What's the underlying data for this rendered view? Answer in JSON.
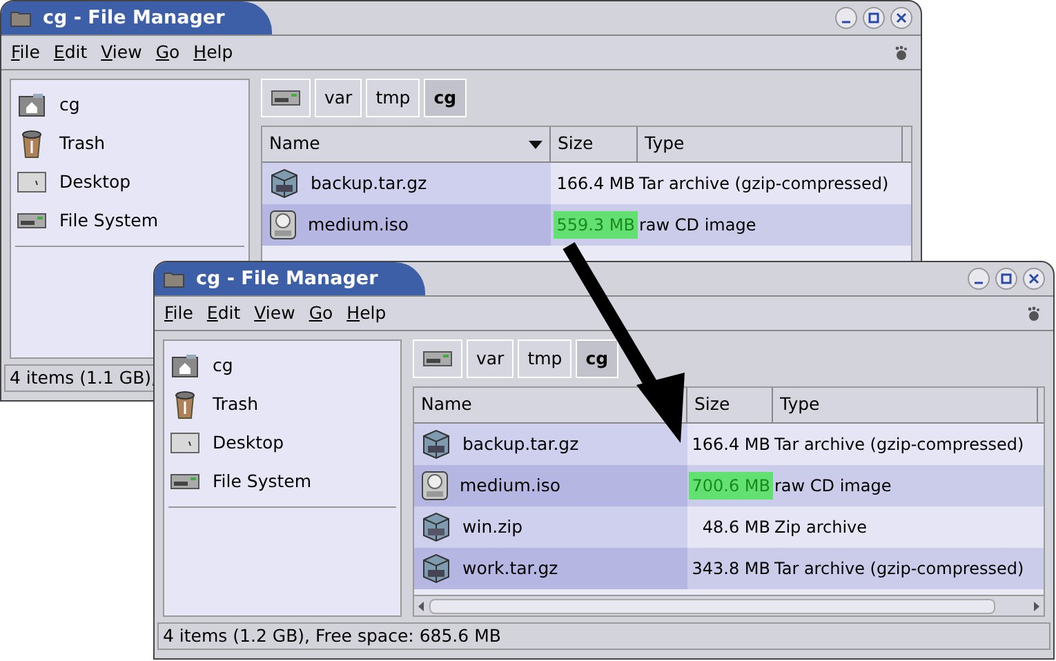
{
  "windows": [
    {
      "title": "cg - File Manager",
      "menu": [
        "File",
        "Edit",
        "View",
        "Go",
        "Help"
      ],
      "places": [
        {
          "label": "cg",
          "kind": "home"
        },
        {
          "label": "Trash",
          "kind": "trash"
        },
        {
          "label": "Desktop",
          "kind": "desktop"
        },
        {
          "label": "File System",
          "kind": "drive"
        }
      ],
      "path": [
        {
          "kind": "drive",
          "selected": false
        },
        {
          "kind": "folder",
          "label": "var",
          "selected": false
        },
        {
          "kind": "folder",
          "label": "tmp",
          "selected": false
        },
        {
          "kind": "folder",
          "label": "cg",
          "selected": true
        }
      ],
      "columns": [
        "Name",
        "Size",
        "Type"
      ],
      "rows": [
        {
          "name": "backup.tar.gz",
          "kind": "tgz",
          "size": "166.4 MB",
          "type": "Tar archive (gzip-compressed)",
          "highlighted": false
        },
        {
          "name": "medium.iso",
          "kind": "iso",
          "size": "559.3 MB",
          "type": "raw CD image",
          "highlighted": true
        }
      ],
      "status": "4 items (1.1 GB),"
    },
    {
      "title": "cg - File Manager",
      "menu": [
        "File",
        "Edit",
        "View",
        "Go",
        "Help"
      ],
      "places": [
        {
          "label": "cg",
          "kind": "home"
        },
        {
          "label": "Trash",
          "kind": "trash"
        },
        {
          "label": "Desktop",
          "kind": "desktop"
        },
        {
          "label": "File System",
          "kind": "drive"
        }
      ],
      "path": [
        {
          "kind": "drive",
          "selected": false
        },
        {
          "kind": "folder",
          "label": "var",
          "selected": false
        },
        {
          "kind": "folder",
          "label": "tmp",
          "selected": false
        },
        {
          "kind": "folder",
          "label": "cg",
          "selected": true
        }
      ],
      "columns": [
        "Name",
        "Size",
        "Type"
      ],
      "rows": [
        {
          "name": "backup.tar.gz",
          "kind": "tgz",
          "size": "166.4 MB",
          "type": "Tar archive (gzip-compressed)",
          "highlighted": false
        },
        {
          "name": "medium.iso",
          "kind": "iso",
          "size": "700.6 MB",
          "type": "raw CD image",
          "highlighted": true
        },
        {
          "name": "win.zip",
          "kind": "zip",
          "size": "48.6 MB",
          "type": "Zip archive",
          "highlighted": false
        },
        {
          "name": "work.tar.gz",
          "kind": "tgz",
          "size": "343.8 MB",
          "type": "Tar archive (gzip-compressed)",
          "highlighted": false
        }
      ],
      "status": "4 items (1.2 GB), Free space: 685.6 MB"
    }
  ]
}
